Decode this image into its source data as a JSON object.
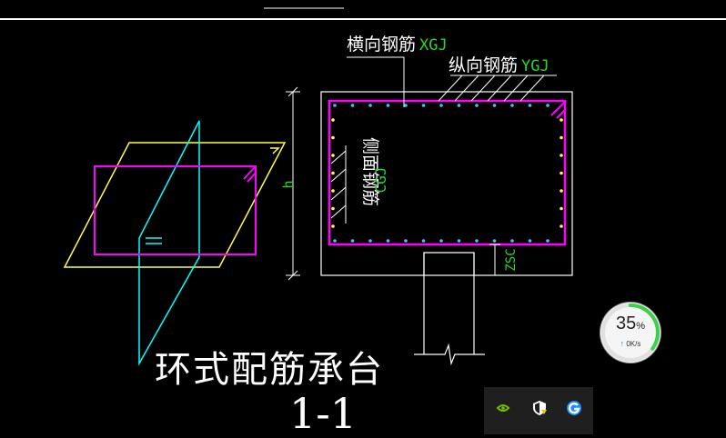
{
  "drawing": {
    "title_main": "环式配筋承台",
    "title_section": "1-1",
    "labels": {
      "transverse_cn": "横向钢筋",
      "transverse_code": "XGJ",
      "longitudinal_cn": "纵向钢筋",
      "longitudinal_code": "YGJ",
      "side_cn": "侧面钢筋",
      "side_code": "CGJ",
      "height": "h",
      "cover": "ZSC"
    },
    "colors": {
      "rebar": "#ff00ff",
      "dots": "#33ccee",
      "dots_side": "#ffff44",
      "plane": "#ffff44",
      "axis": "#00ffff",
      "code_text": "#2bd62b"
    }
  },
  "widget": {
    "percent": "35",
    "percent_unit": "%",
    "rate": "0K/s",
    "progress": 0.35
  },
  "tray": {
    "icons": [
      "nvidia-icon",
      "security-shield-icon",
      "browser-icon"
    ]
  }
}
